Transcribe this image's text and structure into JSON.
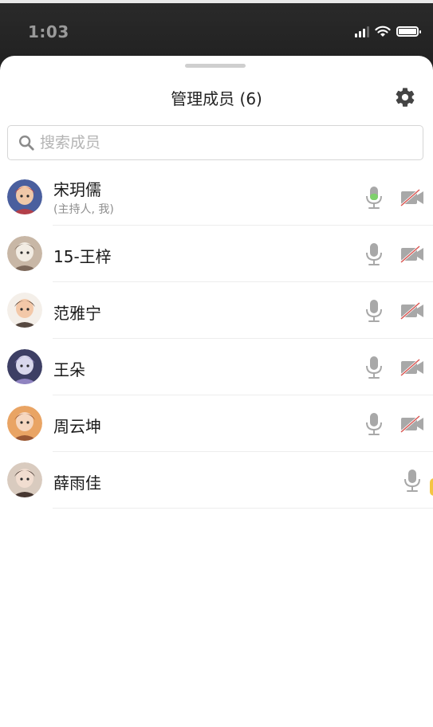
{
  "status_bar": {
    "time": "1:03"
  },
  "sheet": {
    "title": "管理成员 (6)",
    "settings_icon": "gear-icon",
    "search": {
      "placeholder": "搜索成员",
      "value": "",
      "icon": "search-icon"
    }
  },
  "members": [
    {
      "name": "宋玥儒",
      "sub": "(主持人, 我)",
      "mic": "on",
      "video": "off",
      "avatar_colors": [
        "#4a5f9e",
        "#f0c8a8",
        "#c53a3a"
      ]
    },
    {
      "name": "15-王梓",
      "sub": "",
      "mic": "muted",
      "video": "off",
      "avatar_colors": [
        "#c8b7a6",
        "#f2ece3",
        "#6e5a4c"
      ]
    },
    {
      "name": "范雅宁",
      "sub": "",
      "mic": "muted",
      "video": "off",
      "avatar_colors": [
        "#f4efe9",
        "#f3c8a8",
        "#3a2a22"
      ]
    },
    {
      "name": "王朵",
      "sub": "",
      "mic": "muted",
      "video": "off",
      "avatar_colors": [
        "#3d3f64",
        "#d9d8ec",
        "#9e8fd0"
      ]
    },
    {
      "name": "周云坤",
      "sub": "",
      "mic": "muted",
      "video": "off",
      "avatar_colors": [
        "#e9a464",
        "#f6d7c0",
        "#8b4a2b"
      ]
    },
    {
      "name": "薛雨佳",
      "sub": "",
      "mic": "muted",
      "video": "none",
      "avatar_colors": [
        "#d9cbbf",
        "#f1ddd0",
        "#2b1c16"
      ]
    }
  ],
  "colors": {
    "mic_active": "#7ed06b",
    "icon_gray": "#a8a8a8",
    "video_off_slash": "#d9534f"
  }
}
